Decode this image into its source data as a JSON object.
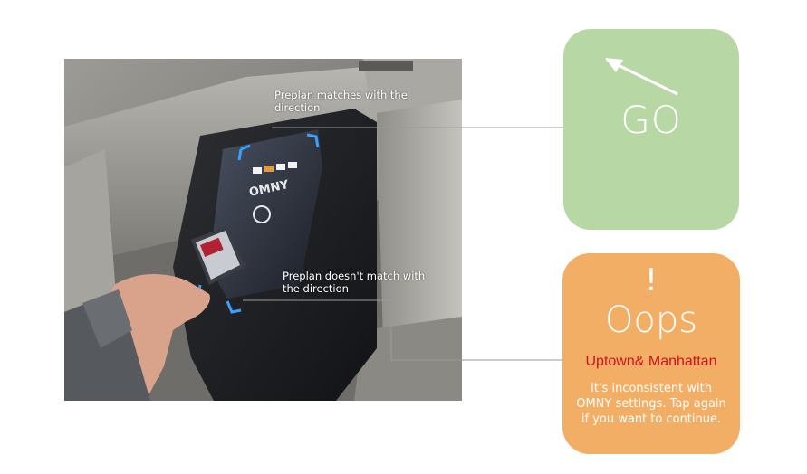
{
  "photo": {
    "description_icon": "omny-turnstile-photo",
    "reader_brand": "OMNY"
  },
  "annotations": {
    "go_line": "Preplan matches with the direction",
    "oops_line": "Preplan doesn't match with the direction"
  },
  "go_card": {
    "label": "GO",
    "icon": "diagonal-arrow-icon",
    "color": "#b7d8a4"
  },
  "oops_card": {
    "icon_text": "!",
    "title": "Oops",
    "direction": "Uptown& Manhattan",
    "message": "It's inconsistent with OMNY settings. Tap again if you want to continue.",
    "color": "#f3ae66",
    "direction_color": "#d0121b"
  }
}
